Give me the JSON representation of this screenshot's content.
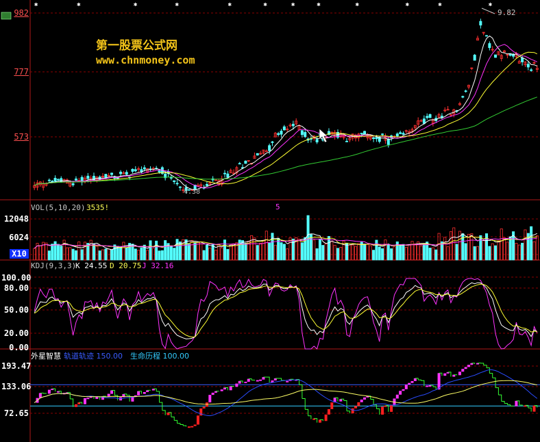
{
  "watermark": {
    "title": "第一股票公式网",
    "url": "www.chnmoney.com"
  },
  "colors": {
    "up": "#ff3030",
    "down": "#54ffff",
    "ma5": "#ffffff",
    "ma10": "#ff33ff",
    "ma20": "#ffff33",
    "ma60": "#33cc33",
    "k": "#ffffff",
    "d": "#ffff33",
    "j": "#ff33ff",
    "grid": "#8b0000",
    "axis": "#b01818"
  },
  "chart_data": [
    {
      "panel": "price",
      "type": "candlestick",
      "yticks": [
        "982",
        "777",
        "573"
      ],
      "ylim": [
        400,
        1000
      ],
      "peak_label": "9.82",
      "low_label": "4.38",
      "anchors": [
        [
          0,
          440
        ],
        [
          6,
          460
        ],
        [
          12,
          455
        ],
        [
          20,
          470
        ],
        [
          28,
          475
        ],
        [
          35,
          495
        ],
        [
          40,
          500
        ],
        [
          46,
          470
        ],
        [
          50,
          430
        ],
        [
          56,
          440
        ],
        [
          64,
          470
        ],
        [
          72,
          520
        ],
        [
          78,
          560
        ],
        [
          82,
          610
        ],
        [
          88,
          640
        ],
        [
          93,
          590
        ],
        [
          100,
          615
        ],
        [
          106,
          595
        ],
        [
          112,
          605
        ],
        [
          118,
          590
        ],
        [
          124,
          600
        ],
        [
          130,
          650
        ],
        [
          136,
          660
        ],
        [
          142,
          690
        ],
        [
          146,
          760
        ],
        [
          150,
          960
        ],
        [
          154,
          870
        ],
        [
          160,
          860
        ],
        [
          166,
          830
        ],
        [
          170,
          810
        ]
      ],
      "count": 170
    },
    {
      "panel": "volume",
      "type": "bar",
      "indicator": "VOL(5,10,20)",
      "last_value": "3535!",
      "yticks": [
        "12048",
        "6024"
      ],
      "multiplier_label": "X10",
      "highlight_label": "5",
      "ylim": [
        0,
        18000
      ]
    },
    {
      "panel": "kdj",
      "type": "line",
      "indicator": "KDJ(9,3,3)",
      "k_label": "K 24.55",
      "d_label": "D 20.75",
      "j_label": "J 32.16",
      "yticks": [
        "100.00",
        "80.00",
        "50.00",
        "20.00",
        "0.00"
      ],
      "ylim": [
        0,
        100
      ]
    },
    {
      "panel": "custom",
      "type": "step",
      "indicator": "外星智慧",
      "orbit_label": "轨道轨迹 150.00",
      "life_label": "生命历程 100.00",
      "yticks": [
        "193.47",
        "133.06",
        "72.65"
      ],
      "ylim": [
        20,
        210
      ]
    }
  ]
}
